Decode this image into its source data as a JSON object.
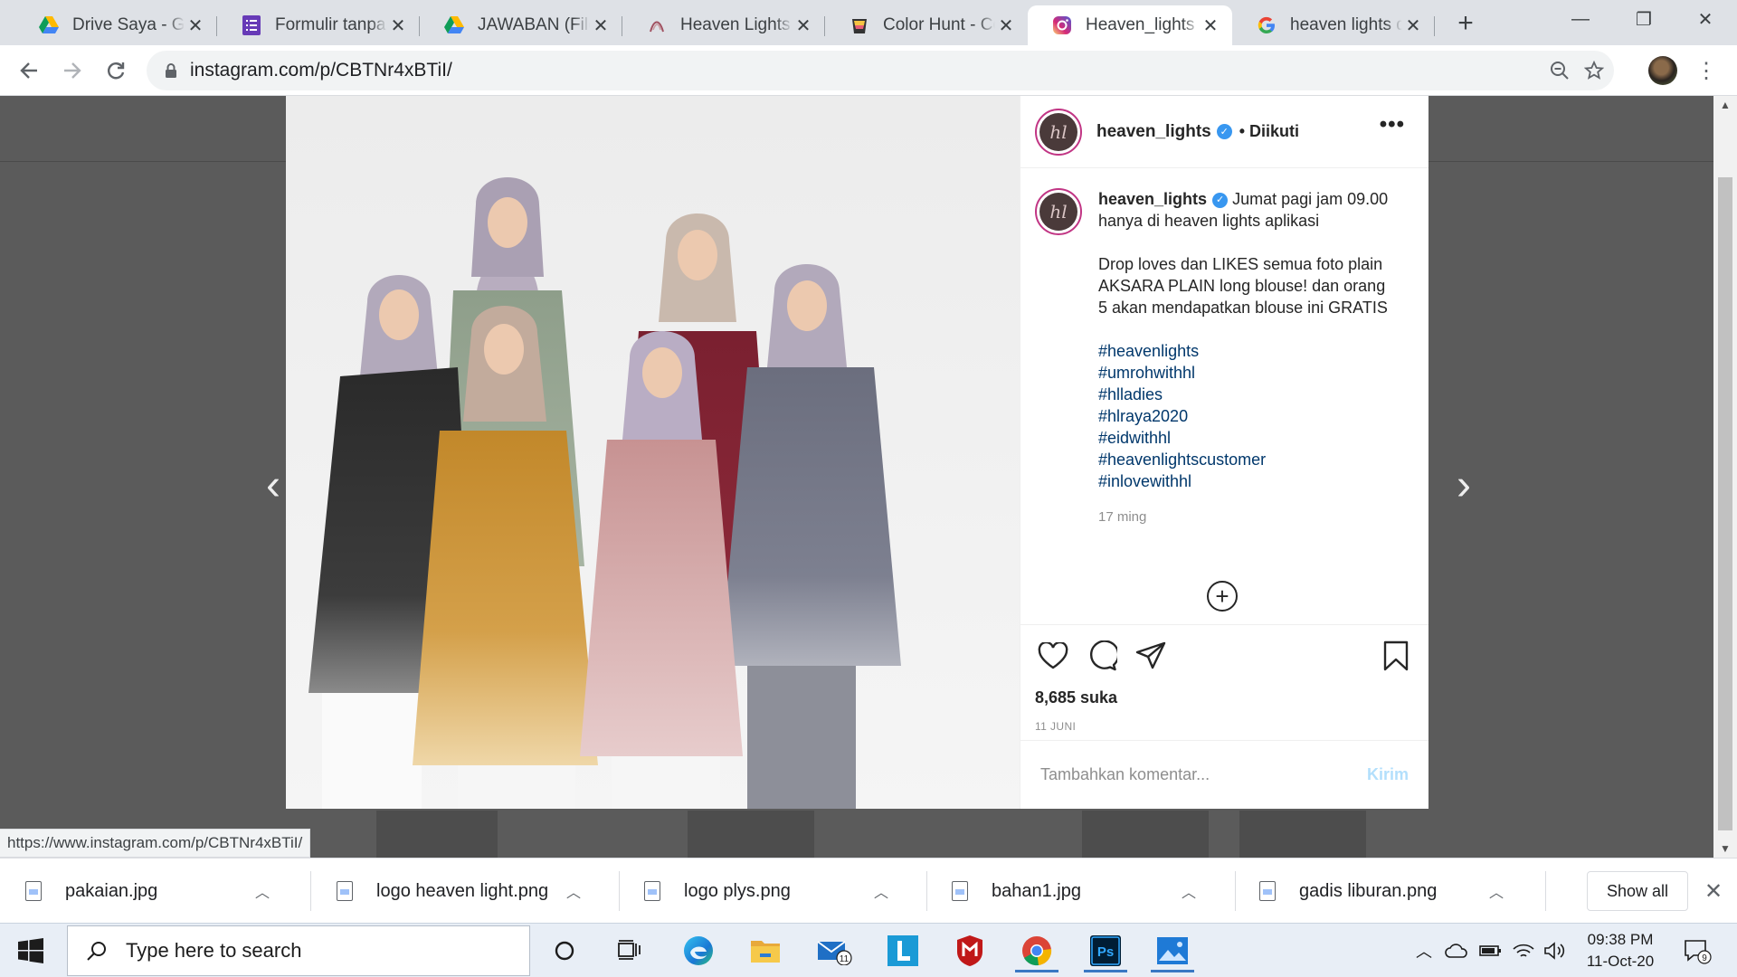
{
  "browser": {
    "tabs": [
      {
        "title": "Drive Saya - Goo",
        "icon": "google-drive-icon"
      },
      {
        "title": "Formulir tanpa ju",
        "icon": "google-forms-icon"
      },
      {
        "title": "JAWABAN (File re",
        "icon": "google-drive-icon"
      },
      {
        "title": "Heaven Lights",
        "icon": "heaven-lights-icon"
      },
      {
        "title": "Color Hunt - Colo",
        "icon": "color-hunt-icon"
      },
      {
        "title": "Heaven_lights (@",
        "icon": "instagram-icon"
      },
      {
        "title": "heaven lights dr",
        "icon": "google-icon"
      }
    ],
    "url": "instagram.com/p/CBTNr4xBTiI/",
    "status_url": "https://www.instagram.com/p/CBTNr4xBTiI/"
  },
  "post": {
    "username": "heaven_lights",
    "follow_status": "• Diikuti",
    "caption_line1": "Jumat pagi jam 09.00 hanya di heaven lights aplikasi",
    "caption_line2": "Drop loves dan LIKES semua foto plain AKSARA PLAIN long blouse! dan orang 5 akan mendapatkan blouse ini GRATIS",
    "hashtags": [
      "#heavenlights",
      "#umrohwithhl",
      "#hlladies",
      "#hlraya2020",
      "#eidwithhl",
      "#heavenlightscustomer",
      "#inlovewithhl"
    ],
    "time_ago": "17 ming",
    "likes": "8,685 suka",
    "date": "11 JUNI",
    "comment_placeholder": "Tambahkan komentar...",
    "send_label": "Kirim",
    "avatar_text": "hl"
  },
  "downloads": [
    {
      "name": "pakaian.jpg"
    },
    {
      "name": "logo heaven light.png"
    },
    {
      "name": "logo plys.png"
    },
    {
      "name": "bahan1.jpg"
    },
    {
      "name": "gadis liburan.png"
    }
  ],
  "shelf": {
    "show_all": "Show all"
  },
  "taskbar": {
    "search_placeholder": "Type here to search",
    "mail_badge": "11",
    "notif_badge": "9",
    "time": "09:38 PM",
    "date": "11-Oct-20"
  },
  "colors": {
    "instagram_link": "#00376b",
    "verified": "#3897f0",
    "overlay": "#5b5b5b"
  }
}
